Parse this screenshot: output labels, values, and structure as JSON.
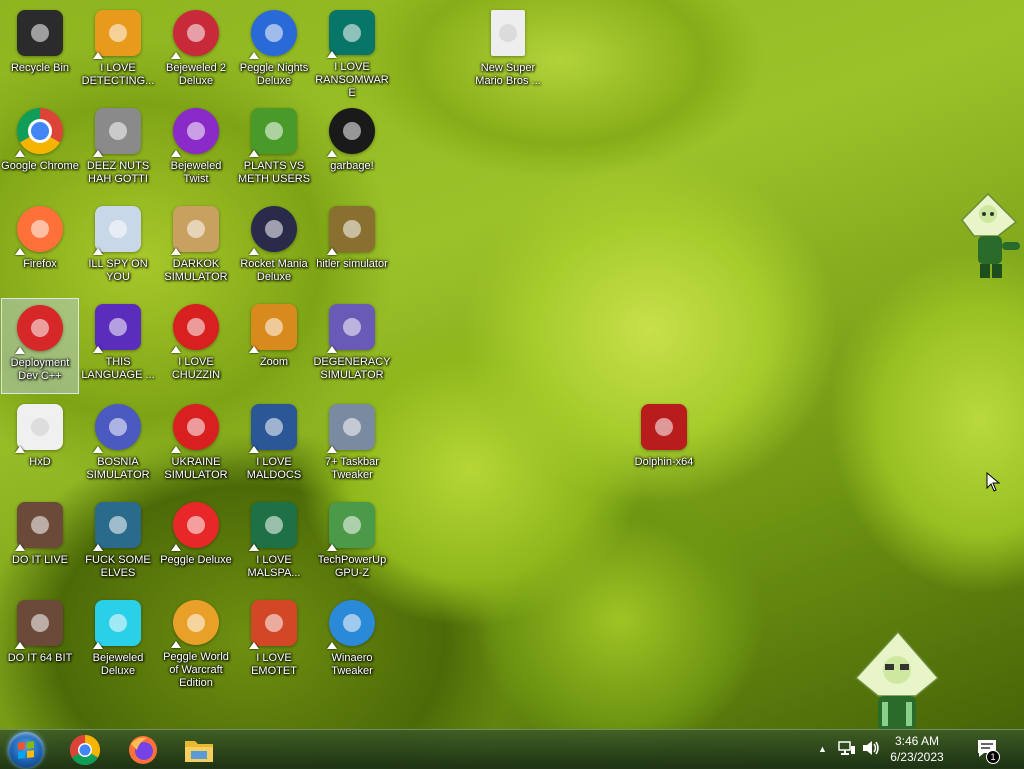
{
  "desktop": {
    "icons": [
      {
        "label": "Recycle Bin",
        "icon": "recycle-bin-icon",
        "color": "#2b2b2b"
      },
      {
        "label": "Google Chrome",
        "icon": "chrome-icon",
        "color": "#4285f4"
      },
      {
        "label": "Firefox",
        "icon": "firefox-icon",
        "color": "#ff7139"
      },
      {
        "label": "Deployment Dev C++",
        "icon": "devcpp-icon",
        "color": "#d62828"
      },
      {
        "label": "HxD",
        "icon": "hxd-icon",
        "color": "#f0f0f0"
      },
      {
        "label": "DO IT LIVE",
        "icon": "portrait-icon",
        "color": "#6b4a3a"
      },
      {
        "label": "DO IT 64 BIT",
        "icon": "portrait-64-icon",
        "color": "#6b4a3a"
      },
      {
        "label": "I LOVE DETECTING...",
        "icon": "die-icon",
        "color": "#e89a1c"
      },
      {
        "label": "DEEZ NUTS HAH GOTTI",
        "icon": "windows-stack-icon",
        "color": "#8a8a8a"
      },
      {
        "label": "ILL SPY ON YOU",
        "icon": "spy-icon",
        "color": "#c8d8e8"
      },
      {
        "label": "THIS LANGUAGE ...",
        "icon": "go-icon",
        "color": "#5a2dbd"
      },
      {
        "label": "BOSNIA SIMULATOR",
        "icon": "mine-icon",
        "color": "#4a5ac0"
      },
      {
        "label": "FUCK SOME ELVES",
        "icon": "santa-icon",
        "color": "#2a6a8a"
      },
      {
        "label": "Bejeweled Deluxe",
        "icon": "diamond-icon",
        "color": "#2ad0e8"
      },
      {
        "label": "Bejeweled 2 Deluxe",
        "icon": "bejeweled2-icon",
        "color": "#c82a3a"
      },
      {
        "label": "Bejeweled Twist",
        "icon": "bejeweled-twist-icon",
        "color": "#8a2ac8"
      },
      {
        "label": "DARKOK SIMULATOR",
        "icon": "money-bag-icon",
        "color": "#c8a060"
      },
      {
        "label": "I LOVE CHUZZIN",
        "icon": "chuzzle-icon",
        "color": "#d82020"
      },
      {
        "label": "UKRAINE SIMULATOR",
        "icon": "radiation-icon",
        "color": "#d82020"
      },
      {
        "label": "Peggle Deluxe",
        "icon": "peggle-icon",
        "color": "#e82828"
      },
      {
        "label": "Peggle World of Warcraft Edition",
        "icon": "peggle-wow-icon",
        "color": "#e8a028"
      },
      {
        "label": "Peggle Nights Deluxe",
        "icon": "peggle-nights-icon",
        "color": "#2a6ad8"
      },
      {
        "label": "PLANTS VS METH USERS",
        "icon": "plants-icon",
        "color": "#4a9a2a"
      },
      {
        "label": "Rocket Mania Deluxe",
        "icon": "rocket-icon",
        "color": "#2a2a4a"
      },
      {
        "label": "Zoom",
        "icon": "zuma-icon",
        "color": "#d88a1c"
      },
      {
        "label": "I LOVE MALDOCS",
        "icon": "word-icon",
        "color": "#2b5797"
      },
      {
        "label": "I LOVE MALSPA...",
        "icon": "excel-icon",
        "color": "#1e7145"
      },
      {
        "label": "I LOVE EMOTET",
        "icon": "powerpoint-icon",
        "color": "#d24726"
      },
      {
        "label": "I LOVE RANSOMWARE",
        "icon": "publisher-icon",
        "color": "#077568"
      },
      {
        "label": "garbage!",
        "icon": "gear-dragon-icon",
        "color": "#1a1a1a"
      },
      {
        "label": "hitler simulator",
        "icon": "coin-icon",
        "color": "#8a7030"
      },
      {
        "label": "DEGENERACY SIMULATOR",
        "icon": "heart-icon",
        "color": "#6a5ab8"
      },
      {
        "label": "7+ Taskbar Tweaker",
        "icon": "tweaker-icon",
        "color": "#7a8aa0"
      },
      {
        "label": "TechPowerUp GPU-Z",
        "icon": "gpuz-icon",
        "color": "#4a9a4a"
      },
      {
        "label": "Winaero Tweaker",
        "icon": "winaero-icon",
        "color": "#2a8ad8"
      },
      {
        "label": "New Super Mario Bros ...",
        "icon": "blank-file-icon",
        "color": "#eeeeee"
      },
      {
        "label": "Dolphin-x64",
        "icon": "dolphin-icon",
        "color": "#b81c1c"
      }
    ]
  },
  "taskbar": {
    "pinned": [
      {
        "name": "chrome-taskbar-button",
        "icon": "chrome-icon"
      },
      {
        "name": "firefox-taskbar-button",
        "icon": "firefox-icon"
      },
      {
        "name": "explorer-taskbar-button",
        "icon": "folder-icon"
      }
    ],
    "tray": {
      "show_hidden": "▲",
      "notification_count": "1"
    },
    "clock": {
      "time": "3:46 AM",
      "date": "6/23/2023"
    }
  }
}
